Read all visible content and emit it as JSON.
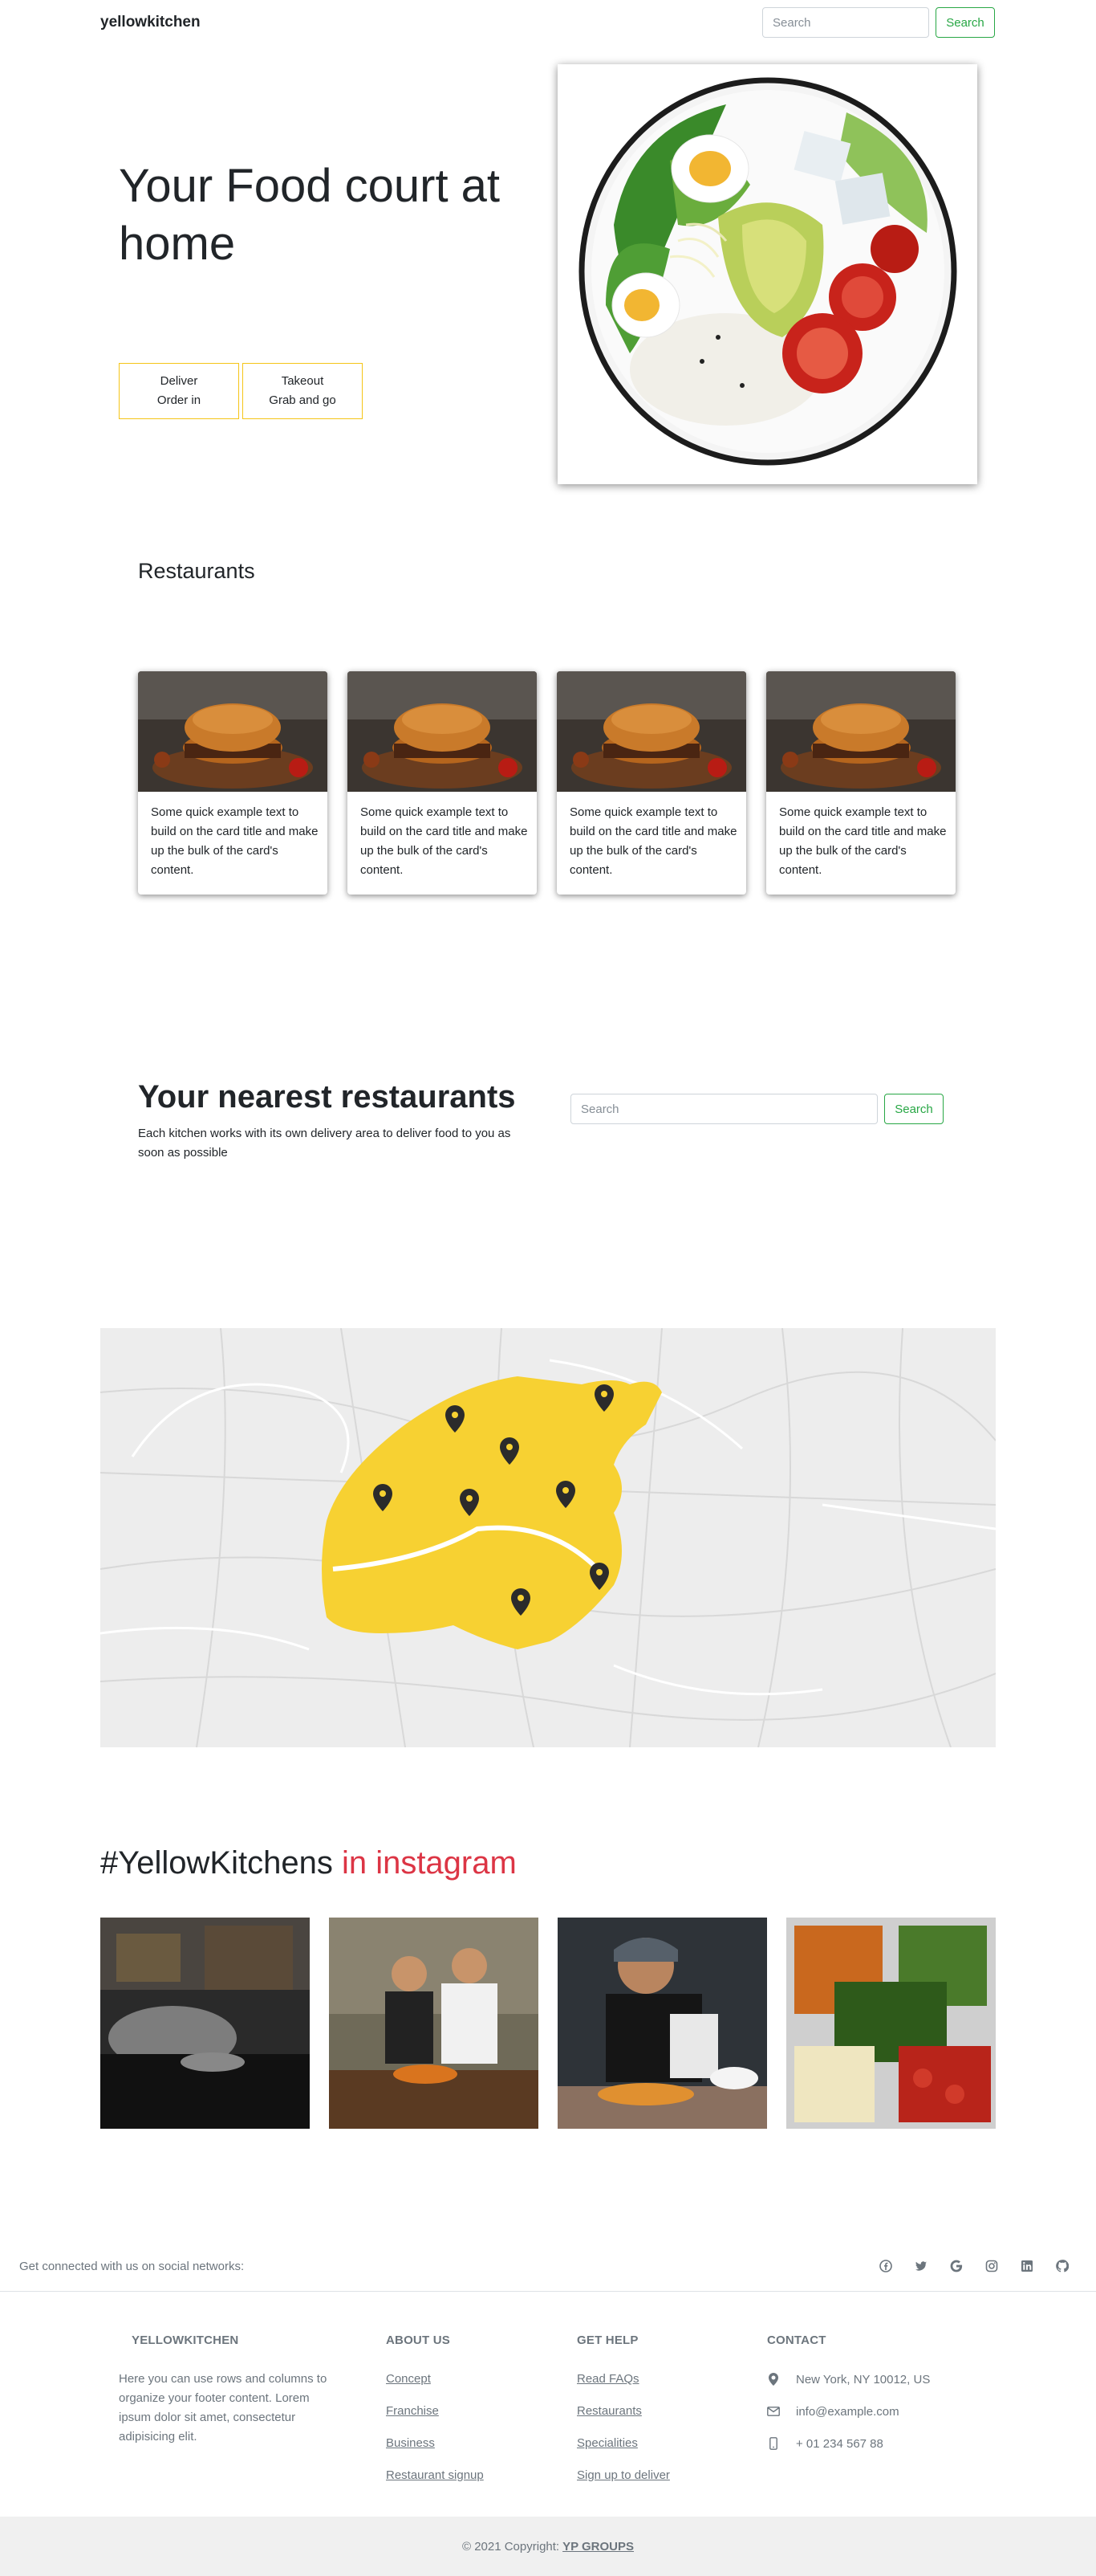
{
  "navbar": {
    "brand": "yellowkitchen",
    "search_placeholder": "Search",
    "search_button": "Search"
  },
  "hero": {
    "title": "Your Food court at home",
    "deliver": {
      "title": "Deliver",
      "subtitle": "Order in"
    },
    "takeout": {
      "title": "Takeout",
      "subtitle": "Grab and go"
    },
    "image_icon": "salad-bowl-image"
  },
  "restaurants": {
    "title": "Restaurants",
    "cards": [
      {
        "text": "Some quick example text to build on the card title and make up the bulk of the card's content."
      },
      {
        "text": "Some quick example text to build on the card title and make up the bulk of the card's content."
      },
      {
        "text": "Some quick example text to build on the card title and make up the bulk of the card's content."
      },
      {
        "text": "Some quick example text to build on the card title and make up the bulk of the card's content."
      }
    ]
  },
  "nearest": {
    "title": "Your nearest restaurants",
    "subtitle": "Each kitchen works with its own delivery area to deliver food to you as soon as possible",
    "search_placeholder": "Search",
    "search_button": "Search"
  },
  "map": {
    "area_color": "#f7d132",
    "marker_count": 8
  },
  "instagram": {
    "title_main": "#YellowKitchens",
    "title_accent": " in instagram",
    "accent_color": "#dc3545"
  },
  "social": {
    "text": "Get connected with us on social networks:",
    "icons": [
      "facebook-icon",
      "twitter-icon",
      "google-icon",
      "instagram-icon",
      "linkedin-icon",
      "github-icon"
    ]
  },
  "footer": {
    "about": {
      "heading": "YELLOWKITCHEN",
      "text": "Here you can use rows and columns to organize your footer content. Lorem ipsum dolor sit amet, consectetur adipisicing elit."
    },
    "about_us": {
      "heading": "ABOUT US",
      "links": [
        "Concept",
        "Franchise",
        "Business",
        "Restaurant signup"
      ]
    },
    "get_help": {
      "heading": "GET HELP",
      "links": [
        "Read FAQs",
        "Restaurants",
        "Specialities",
        "Sign up to deliver"
      ]
    },
    "contact": {
      "heading": "CONTACT",
      "address": "New York, NY 10012, US",
      "email": "info@example.com",
      "phone": "+ 01 234 567 88"
    },
    "copyright": "© 2021 Copyright:",
    "copyright_owner": "YP GROUPS"
  }
}
